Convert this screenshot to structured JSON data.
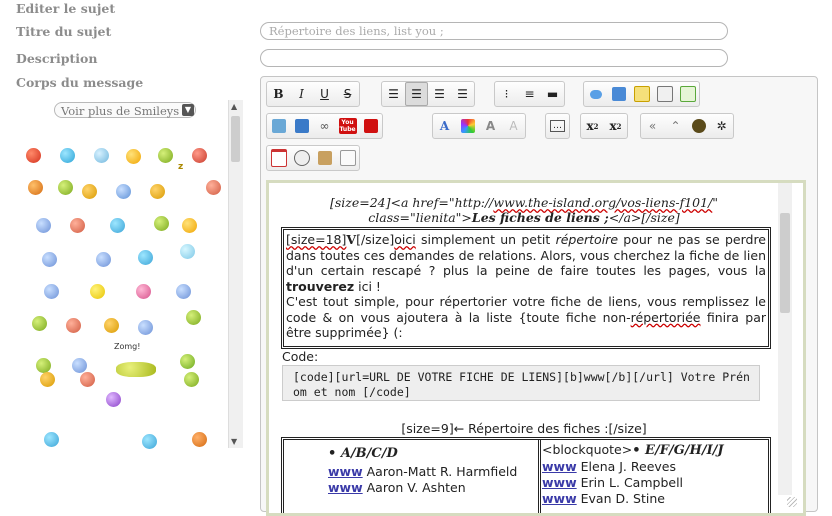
{
  "form": {
    "edit_subject_label": "Editer le sujet",
    "title_label": "Titre du sujet",
    "title_value": "Répertoire des liens, list you ;",
    "description_label": "Description",
    "description_value": "",
    "body_label": "Corps du message"
  },
  "smileys": {
    "select_label": "Voir plus de Smileys",
    "zomg_text": "Zomg!",
    "z_text": "z"
  },
  "toolbar": {
    "bold": "B",
    "italic": "I",
    "underline": "U",
    "strike": "S",
    "subscript": "x",
    "subscript_digit": "2",
    "superscript": "x",
    "superscript_digit": "2",
    "youtube": "You Tube"
  },
  "content": {
    "heading_open": "[size=24]<a href=\"http://",
    "heading_url": "www.the-island.org/vos-liens-f101/",
    "heading_close_quote": "\"",
    "heading_class": "class=\"lienita\">",
    "heading_title": "Les fiches de liens ;",
    "heading_end": "</a>[/size]",
    "para1_size_tag": "[size=18]",
    "para1_v": "V",
    "para1_size_close": "[/size]",
    "para1_oici": "oici",
    "para1_text_a": " simplement un petit ",
    "para1_repertoire": "répertoire",
    "para1_text_b": " pour ne pas se perdre dans toutes ces demandes de relations. Alors, vous cherchez la fiche de lien d'un certain rescapé ? plus la peine de faire toutes les pages, vous la ",
    "para1_trouverez": "trouverez",
    "para1_text_c": " ici !",
    "para2": "C'est tout simple, pour répertorier votre fiche de liens, vous remplissez le code & on vous ajoutera à la liste {toute  fiche non-",
    "para2_repertoriee": "répertoriée",
    "para2_tail": " finira par être supprimée} (:",
    "code_label": "Code:",
    "code_text": "[code][url=URL DE VOTRE FICHE DE LIENS][b]www[/b][/url] Votre Prénom et nom [/code]",
    "fiches_line": "[size=9]← Répertoire des fiches :[/size]",
    "col1_header": "• A/B/C/D",
    "col1_items": [
      {
        "www": "www",
        "name": " Aaron-Matt R. Harmfield"
      },
      {
        "www": "www",
        "name": " Aaron V. Ashten"
      }
    ],
    "col2_prefix": "<blockquote>",
    "col2_header": "• E/F/G/H/I/J",
    "col2_items": [
      {
        "www": "www",
        "name": " Elena J. Reeves"
      },
      {
        "www": "www",
        "name": " Erin L. Campbell"
      },
      {
        "www": "www",
        "name": " Evan D. Stine"
      }
    ]
  }
}
